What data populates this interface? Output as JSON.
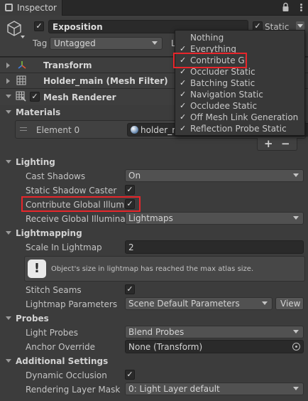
{
  "window": {
    "tab_title": "Inspector"
  },
  "gameobject": {
    "name": "Exposition",
    "static_label": "Static",
    "tag_label": "Tag",
    "tag_value": "Untagged",
    "layer_label": "L"
  },
  "static_menu": {
    "items": [
      {
        "label": "Nothing",
        "checked": false
      },
      {
        "label": "Everything",
        "checked": true
      },
      {
        "label": "Contribute GI",
        "checked": true
      },
      {
        "label": "Occluder Static",
        "checked": true
      },
      {
        "label": "Batching Static",
        "checked": true
      },
      {
        "label": "Navigation Static",
        "checked": true
      },
      {
        "label": "Occludee Static",
        "checked": true
      },
      {
        "label": "Off Mesh Link Generation",
        "checked": true
      },
      {
        "label": "Reflection Probe Static",
        "checked": true
      }
    ]
  },
  "components": {
    "transform": "Transform",
    "mesh_filter": "Holder_main (Mesh Filter)",
    "mesh_renderer": "Mesh Renderer"
  },
  "materials": {
    "header": "Materials",
    "element0_label": "Element 0",
    "element0_value": "holder_m",
    "add": "+",
    "remove": "−"
  },
  "lighting": {
    "header": "Lighting",
    "cast_shadows_label": "Cast Shadows",
    "cast_shadows_value": "On",
    "static_shadow_label": "Static Shadow Caster",
    "static_shadow_checked": true,
    "contribute_gi_label": "Contribute Global Illumin",
    "contribute_gi_checked": true,
    "receive_gi_label": "Receive Global Illuminati",
    "receive_gi_value": "Lightmaps"
  },
  "lightmapping": {
    "header": "Lightmapping",
    "scale_label": "Scale In Lightmap",
    "scale_value": "2",
    "warning": "Object's size in lightmap has reached the max atlas size.",
    "stitch_label": "Stitch Seams",
    "stitch_checked": true,
    "params_label": "Lightmap Parameters",
    "params_value": "Scene Default Parameters",
    "view_button": "View"
  },
  "probes": {
    "header": "Probes",
    "light_probes_label": "Light Probes",
    "light_probes_value": "Blend Probes",
    "anchor_label": "Anchor Override",
    "anchor_value": "None (Transform)"
  },
  "additional": {
    "header": "Additional Settings",
    "dynamic_occlusion_label": "Dynamic Occlusion",
    "dynamic_occlusion_checked": true,
    "layer_mask_label": "Rendering Layer Mask",
    "layer_mask_value": "0: Light Layer default"
  },
  "icons": {
    "checkmark": "✓",
    "highlight_color": "#e8262b",
    "accent_color": "#4c7fd9"
  }
}
